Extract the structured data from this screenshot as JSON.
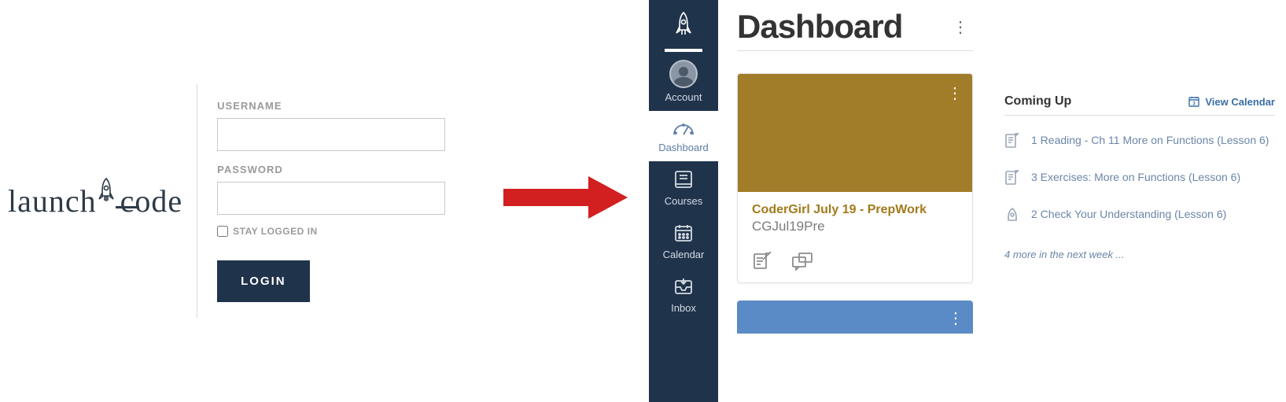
{
  "logo": {
    "part1": "launch",
    "part2": "code"
  },
  "login": {
    "username_label": "USERNAME",
    "password_label": "PASSWORD",
    "stay_label": "STAY LOGGED IN",
    "submit_label": "LOGIN"
  },
  "sidebar": {
    "account": "Account",
    "dashboard": "Dashboard",
    "courses": "Courses",
    "calendar": "Calendar",
    "inbox": "Inbox"
  },
  "dashboard": {
    "title": "Dashboard",
    "cards": [
      {
        "title": "CoderGirl July 19 - PrepWork",
        "subtitle": "CGJul19Pre",
        "color": "#a17d2a"
      },
      {
        "color": "#5a8bc6"
      }
    ]
  },
  "coming_up": {
    "heading": "Coming Up",
    "view_calendar": "View Calendar",
    "items": [
      "1 Reading - Ch 11 More on Functions (Lesson 6)",
      "3 Exercises: More on Functions (Lesson 6)",
      "2 Check Your Understanding (Lesson 6)"
    ],
    "more": "4 more in the next week ..."
  }
}
